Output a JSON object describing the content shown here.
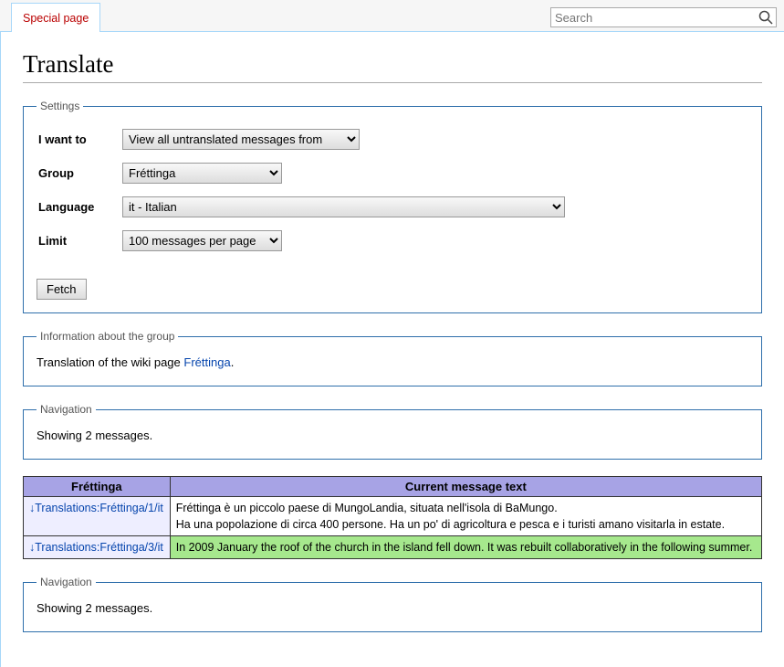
{
  "tab_label": "Special page",
  "search_placeholder": "Search",
  "page_title": "Translate",
  "settings": {
    "legend": "Settings",
    "fields": {
      "want_label": "I want to",
      "want_value": "View all untranslated messages from",
      "group_label": "Group",
      "group_value": "Fréttinga",
      "lang_label": "Language",
      "lang_value": "it - Italian",
      "limit_label": "Limit",
      "limit_value": "100 messages per page"
    },
    "fetch_button": "Fetch"
  },
  "group_info": {
    "legend": "Information about the group",
    "prefix": "Translation of the wiki page ",
    "link": "Fréttinga",
    "suffix": "."
  },
  "nav": {
    "legend": "Navigation",
    "text": "Showing 2 messages."
  },
  "table": {
    "col1": "Fréttinga",
    "col2": "Current message text",
    "rows": [
      {
        "arrow": "↓",
        "title": "Translations:Fréttinga/1/it",
        "body": "Fréttinga è un piccolo paese di MungoLandia, situata nell'isola di BaMungo.\nHa una popolazione di circa 400 persone. Ha un po' di agricoltura e pesca e i turisti amano visitarla in estate.",
        "green": false
      },
      {
        "arrow": "↓",
        "title": "Translations:Fréttinga/3/it",
        "body": "In 2009 January the roof of the church in the island fell down. It was rebuilt collaboratively in the following summer.",
        "green": true
      }
    ]
  }
}
